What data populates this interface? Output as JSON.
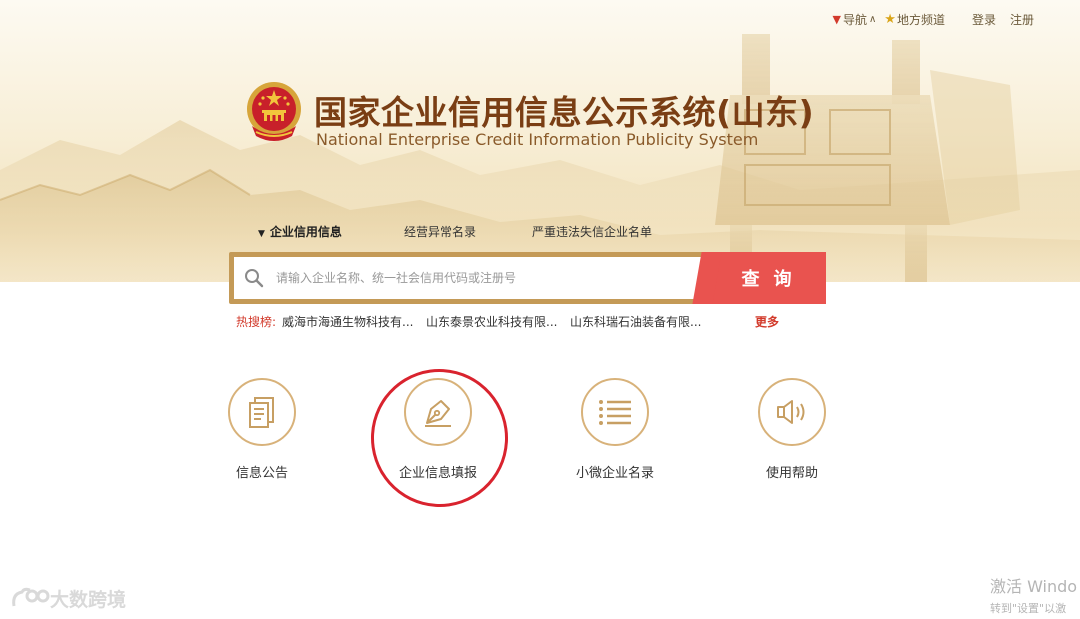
{
  "top_nav": {
    "navigation": "导航",
    "local_channel": "地方频道",
    "login": "登录",
    "register": "注册"
  },
  "header": {
    "title_cn": "国家企业信用信息公示系统(山东)",
    "title_en": "National Enterprise Credit Information Publicity System"
  },
  "tabs": [
    {
      "label": "企业信用信息",
      "active": true
    },
    {
      "label": "经营异常名录",
      "active": false
    },
    {
      "label": "严重违法失信企业名单",
      "active": false
    }
  ],
  "search": {
    "placeholder": "请输入企业名称、统一社会信用代码或注册号",
    "button_label": "查询"
  },
  "hot_search": {
    "label": "热搜榜:",
    "items": [
      "威海市海通生物科技有...",
      "山东泰景农业科技有限...",
      "山东科瑞石油装备有限..."
    ],
    "more": "更多"
  },
  "features": [
    {
      "label": "信息公告",
      "icon": "document-icon"
    },
    {
      "label": "企业信息填报",
      "icon": "pen-nib-icon"
    },
    {
      "label": "小微企业名录",
      "icon": "list-icon"
    },
    {
      "label": "使用帮助",
      "icon": "speaker-icon"
    }
  ],
  "watermarks": {
    "brand": "大数跨境",
    "activate_title": "激活 Windo",
    "activate_sub": "转到\"设置\"以激"
  },
  "colors": {
    "accent_gold": "#c49a57",
    "search_red": "#e9534f",
    "title_brown": "#7a3e14",
    "highlight_ring": "#d9232e"
  }
}
